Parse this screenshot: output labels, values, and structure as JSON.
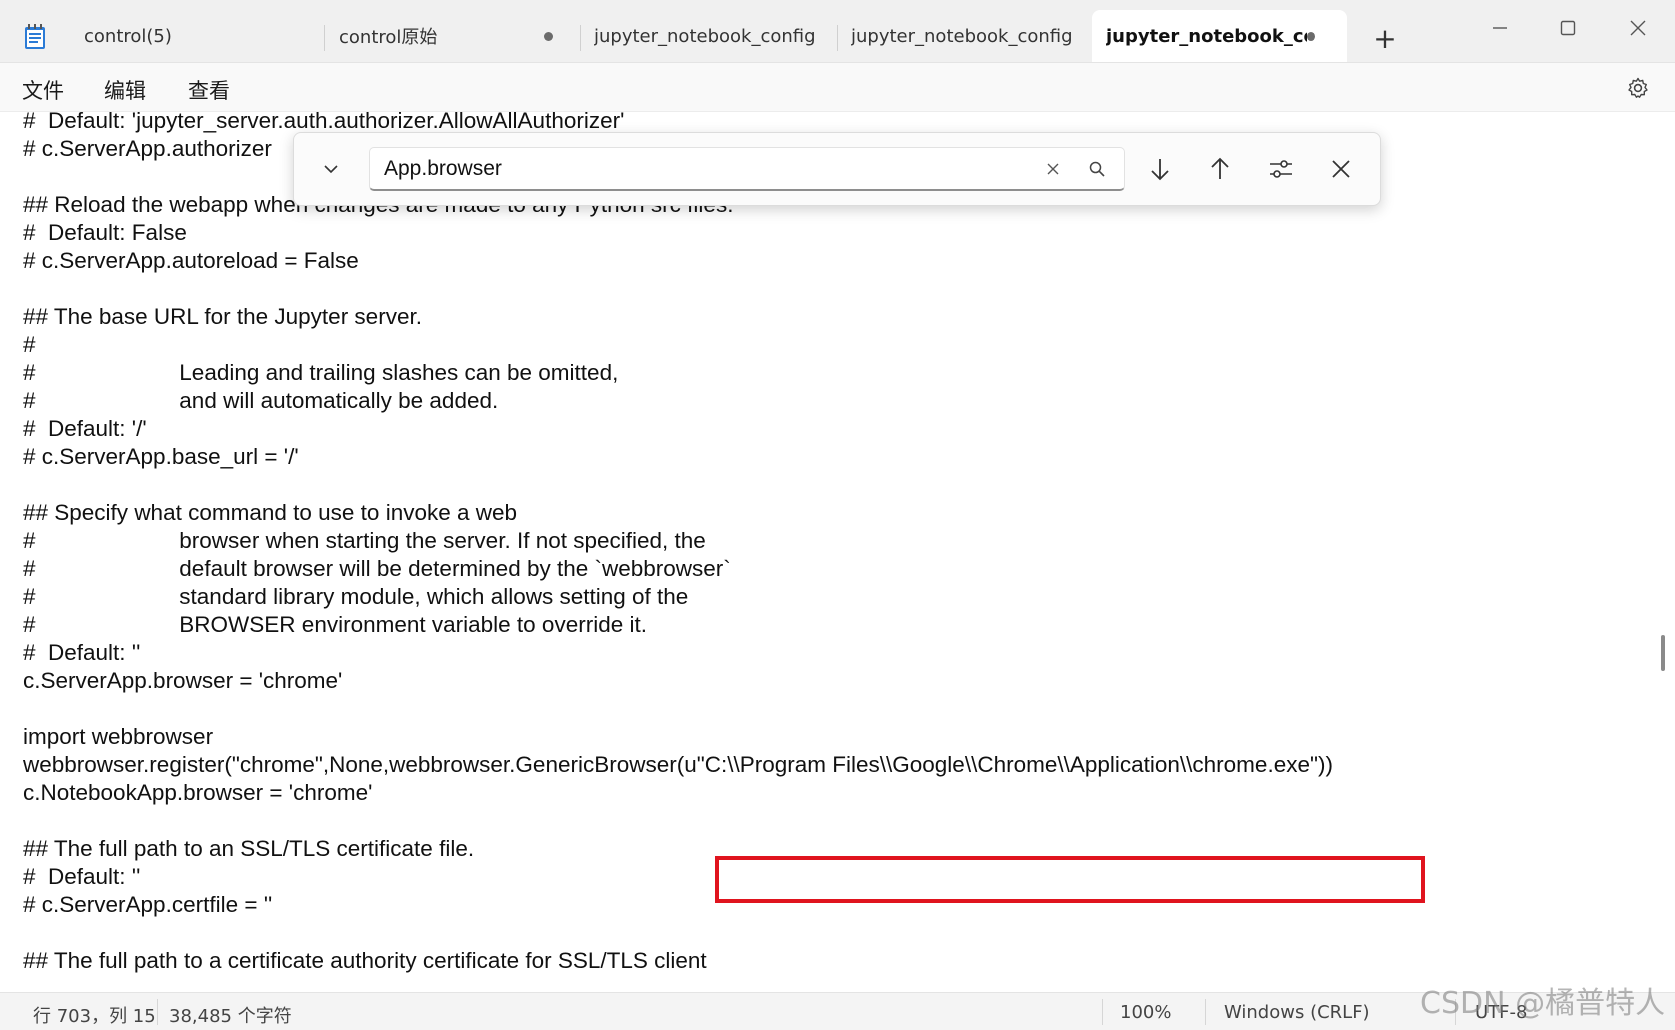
{
  "tabs": [
    {
      "label": "control(5)",
      "modified": false
    },
    {
      "label": "control原始",
      "modified": true
    },
    {
      "label": "jupyter_notebook_config",
      "modified": false
    },
    {
      "label": "jupyter_notebook_config",
      "modified": false
    },
    {
      "label": "jupyter_notebook_con",
      "modified": true,
      "active": true
    }
  ],
  "new_tab": "+",
  "menu": {
    "file": "文件",
    "edit": "编辑",
    "view": "查看"
  },
  "find": {
    "query": "App.browser"
  },
  "code": [
    "#  Default: 'jupyter_server.auth.authorizer.AllowAllAuthorizer'",
    "# c.ServerApp.authorizer",
    "",
    "## Reload the webapp when changes are made to any Python src files.",
    "#  Default: False",
    "# c.ServerApp.autoreload = False",
    "",
    "## The base URL for the Jupyter server.",
    "#",
    "#                       Leading and trailing slashes can be omitted,",
    "#                       and will automatically be added.",
    "#  Default: '/'",
    "# c.ServerApp.base_url = '/'",
    "",
    "## Specify what command to use to invoke a web",
    "#                       browser when starting the server. If not specified, the",
    "#                       default browser will be determined by the `webbrowser`",
    "#                       standard library module, which allows setting of the",
    "#                       BROWSER environment variable to override it.",
    "#  Default: ''",
    "c.ServerApp.browser = 'chrome'",
    "",
    "import webbrowser",
    "webbrowser.register(\"chrome\",None,webbrowser.GenericBrowser(u\"C:\\\\Program Files\\\\Google\\\\Chrome\\\\Application\\\\chrome.exe\"))",
    "c.NotebookApp.browser = 'chrome'",
    "",
    "## The full path to an SSL/TLS certificate file.",
    "#  Default: ''",
    "# c.ServerApp.certfile = ''",
    "",
    "## The full path to a certificate authority certificate for SSL/TLS client"
  ],
  "status": {
    "position": "行 703，列 15",
    "chars": "38,485 个字符",
    "zoom": "100%",
    "line_ending": "Windows (CRLF)",
    "encoding": "UTF-8"
  },
  "watermark": "CSDN @橘普特人",
  "colors": {
    "highlight": "#e0141e",
    "accent": "#2b7bd6"
  }
}
